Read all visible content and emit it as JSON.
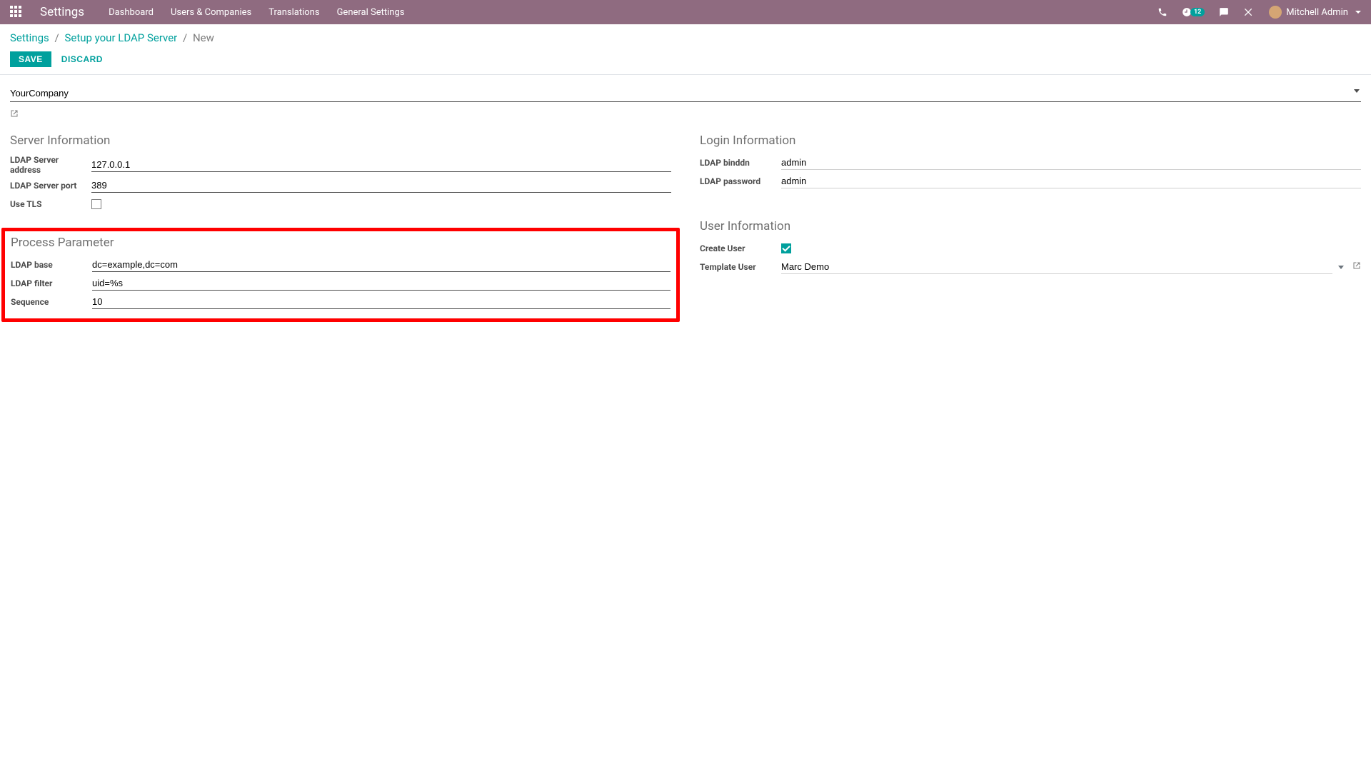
{
  "topbar": {
    "brand": "Settings",
    "menu": [
      "Dashboard",
      "Users & Companies",
      "Translations",
      "General Settings"
    ],
    "activity_badge": "12",
    "user_name": "Mitchell Admin"
  },
  "breadcrumb": {
    "root": "Settings",
    "mid": "Setup your LDAP Server",
    "current": "New"
  },
  "actions": {
    "save": "SAVE",
    "discard": "DISCARD"
  },
  "company": {
    "value": "YourCompany"
  },
  "server_info": {
    "title": "Server Information",
    "address_label": "LDAP Server address",
    "address_value": "127.0.0.1",
    "port_label": "LDAP Server port",
    "port_value": "389",
    "tls_label": "Use TLS",
    "tls_checked": false
  },
  "login_info": {
    "title": "Login Information",
    "binddn_label": "LDAP binddn",
    "binddn_value": "admin",
    "password_label": "LDAP password",
    "password_value": "admin"
  },
  "process": {
    "title": "Process Parameter",
    "base_label": "LDAP base",
    "base_value": "dc=example,dc=com",
    "filter_label": "LDAP filter",
    "filter_value": "uid=%s",
    "sequence_label": "Sequence",
    "sequence_value": "10"
  },
  "user_info": {
    "title": "User Information",
    "create_user_label": "Create User",
    "create_user_checked": true,
    "template_user_label": "Template User",
    "template_user_value": "Marc Demo"
  }
}
